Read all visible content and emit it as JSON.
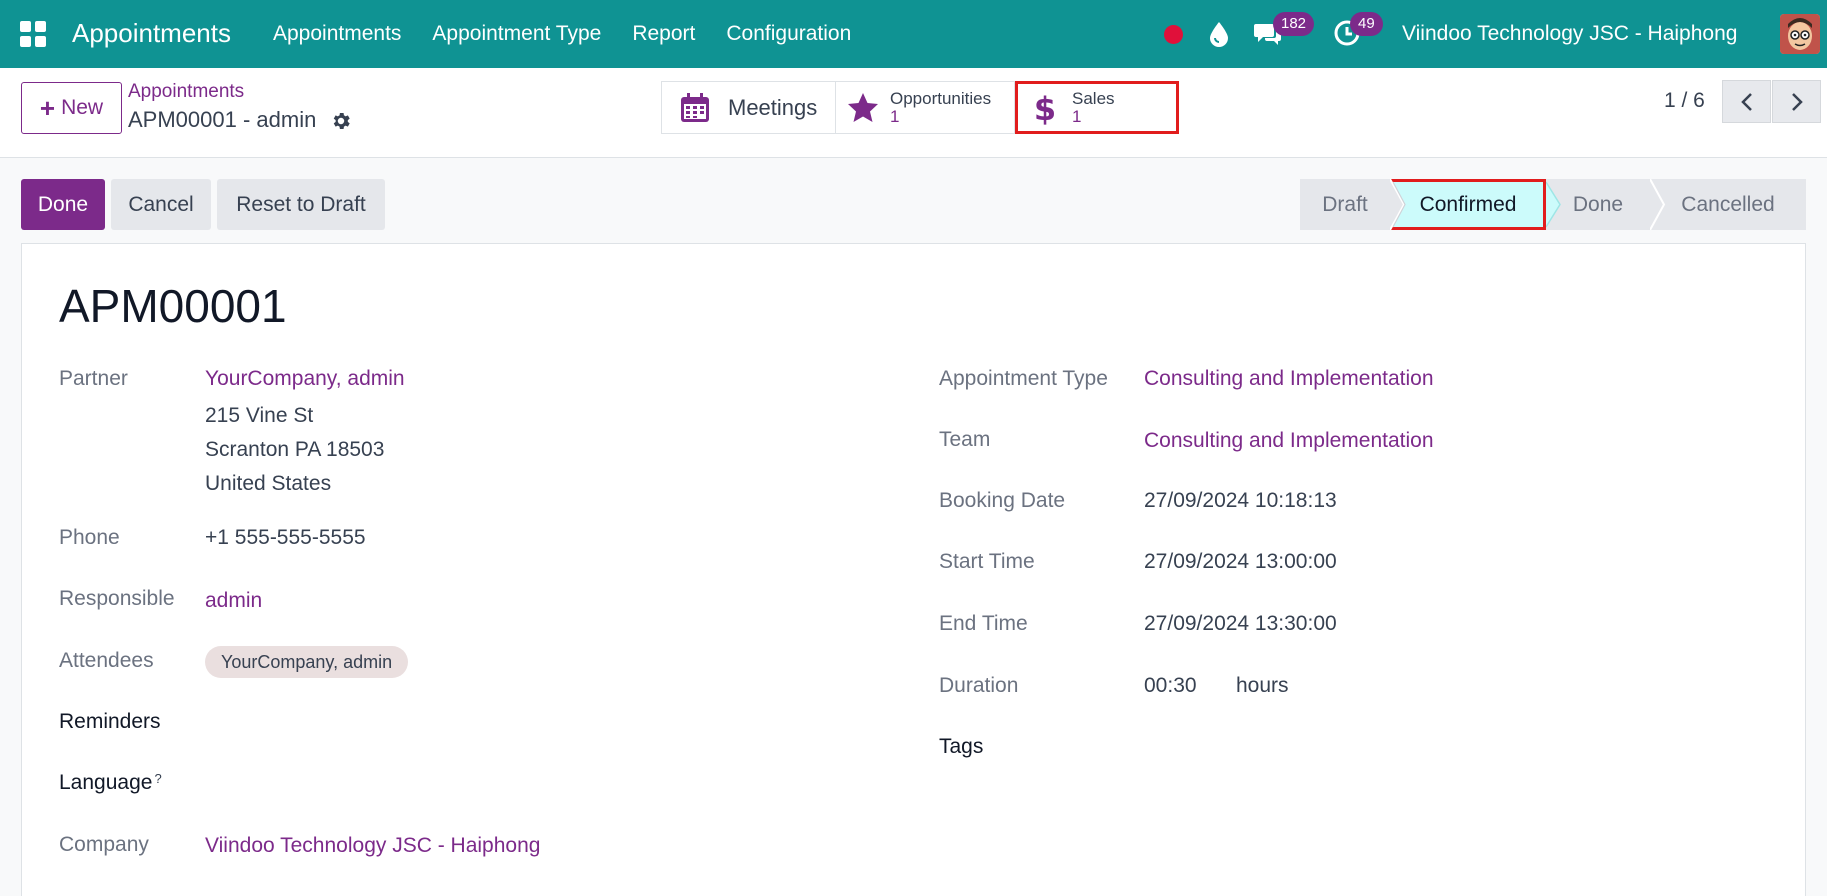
{
  "navbar": {
    "app_name": "Appointments",
    "menu": [
      "Appointments",
      "Appointment Type",
      "Report",
      "Configuration"
    ],
    "messages_count": "182",
    "activities_count": "49",
    "company": "Viindoo Technology JSC - Haiphong"
  },
  "control": {
    "new_label": "New",
    "breadcrumb_parent": "Appointments",
    "breadcrumb_current": "APM00001 - admin",
    "smart_meetings": "Meetings",
    "smart_opportunities_label": "Opportunities",
    "smart_opportunities_count": "1",
    "smart_sales_label": "Sales",
    "smart_sales_count": "1",
    "pager": "1 / 6"
  },
  "status": {
    "done_label": "Done",
    "cancel_label": "Cancel",
    "reset_label": "Reset to Draft",
    "stages": [
      "Draft",
      "Confirmed",
      "Done",
      "Cancelled"
    ],
    "current_stage": "Confirmed"
  },
  "record": {
    "name": "APM00001",
    "left": {
      "partner_label": "Partner",
      "partner_name": "YourCompany, admin",
      "address_line1": "215 Vine St",
      "address_line2": "Scranton PA 18503",
      "address_line3": "United States",
      "phone_label": "Phone",
      "phone": "+1 555-555-5555",
      "responsible_label": "Responsible",
      "responsible": "admin",
      "attendees_label": "Attendees",
      "attendee_tag": "YourCompany, admin",
      "reminders_label": "Reminders",
      "language_label": "Language",
      "language_help": "?",
      "company_label": "Company",
      "company": "Viindoo Technology JSC - Haiphong"
    },
    "right": {
      "type_label": "Appointment Type",
      "type_value": "Consulting and Implementation",
      "team_label": "Team",
      "team_value": "Consulting and Implementation",
      "booking_label": "Booking Date",
      "booking_value": "27/09/2024 10:18:13",
      "start_label": "Start Time",
      "start_value": "27/09/2024 13:00:00",
      "end_label": "End Time",
      "end_value": "27/09/2024 13:30:00",
      "duration_label": "Duration",
      "duration_value": "00:30",
      "duration_unit": "hours",
      "tags_label": "Tags"
    }
  },
  "colors": {
    "navbar": "#0f9393",
    "accent": "#7c2a8a",
    "highlight": "#e11d1d"
  }
}
